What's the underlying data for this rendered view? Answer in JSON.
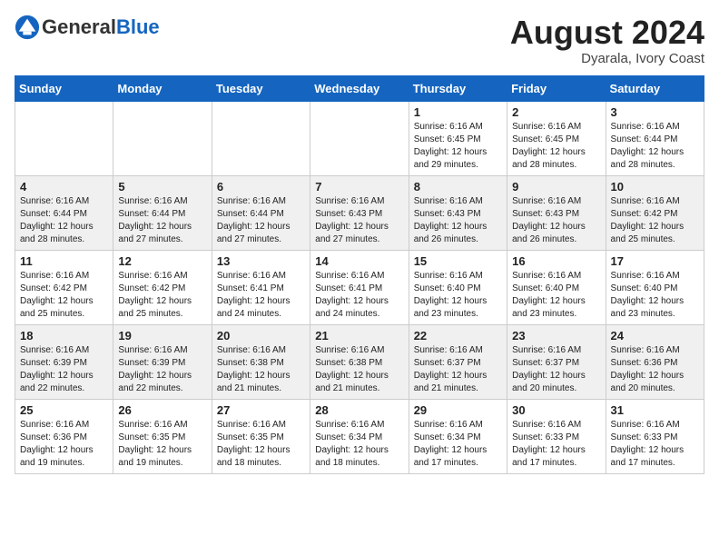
{
  "header": {
    "logo_general": "General",
    "logo_blue": "Blue",
    "month": "August 2024",
    "location": "Dyarala, Ivory Coast"
  },
  "days_of_week": [
    "Sunday",
    "Monday",
    "Tuesday",
    "Wednesday",
    "Thursday",
    "Friday",
    "Saturday"
  ],
  "weeks": [
    [
      {
        "day": "",
        "info": ""
      },
      {
        "day": "",
        "info": ""
      },
      {
        "day": "",
        "info": ""
      },
      {
        "day": "",
        "info": ""
      },
      {
        "day": "1",
        "info": "Sunrise: 6:16 AM\nSunset: 6:45 PM\nDaylight: 12 hours\nand 29 minutes."
      },
      {
        "day": "2",
        "info": "Sunrise: 6:16 AM\nSunset: 6:45 PM\nDaylight: 12 hours\nand 28 minutes."
      },
      {
        "day": "3",
        "info": "Sunrise: 6:16 AM\nSunset: 6:44 PM\nDaylight: 12 hours\nand 28 minutes."
      }
    ],
    [
      {
        "day": "4",
        "info": "Sunrise: 6:16 AM\nSunset: 6:44 PM\nDaylight: 12 hours\nand 28 minutes."
      },
      {
        "day": "5",
        "info": "Sunrise: 6:16 AM\nSunset: 6:44 PM\nDaylight: 12 hours\nand 27 minutes."
      },
      {
        "day": "6",
        "info": "Sunrise: 6:16 AM\nSunset: 6:44 PM\nDaylight: 12 hours\nand 27 minutes."
      },
      {
        "day": "7",
        "info": "Sunrise: 6:16 AM\nSunset: 6:43 PM\nDaylight: 12 hours\nand 27 minutes."
      },
      {
        "day": "8",
        "info": "Sunrise: 6:16 AM\nSunset: 6:43 PM\nDaylight: 12 hours\nand 26 minutes."
      },
      {
        "day": "9",
        "info": "Sunrise: 6:16 AM\nSunset: 6:43 PM\nDaylight: 12 hours\nand 26 minutes."
      },
      {
        "day": "10",
        "info": "Sunrise: 6:16 AM\nSunset: 6:42 PM\nDaylight: 12 hours\nand 25 minutes."
      }
    ],
    [
      {
        "day": "11",
        "info": "Sunrise: 6:16 AM\nSunset: 6:42 PM\nDaylight: 12 hours\nand 25 minutes."
      },
      {
        "day": "12",
        "info": "Sunrise: 6:16 AM\nSunset: 6:42 PM\nDaylight: 12 hours\nand 25 minutes."
      },
      {
        "day": "13",
        "info": "Sunrise: 6:16 AM\nSunset: 6:41 PM\nDaylight: 12 hours\nand 24 minutes."
      },
      {
        "day": "14",
        "info": "Sunrise: 6:16 AM\nSunset: 6:41 PM\nDaylight: 12 hours\nand 24 minutes."
      },
      {
        "day": "15",
        "info": "Sunrise: 6:16 AM\nSunset: 6:40 PM\nDaylight: 12 hours\nand 23 minutes."
      },
      {
        "day": "16",
        "info": "Sunrise: 6:16 AM\nSunset: 6:40 PM\nDaylight: 12 hours\nand 23 minutes."
      },
      {
        "day": "17",
        "info": "Sunrise: 6:16 AM\nSunset: 6:40 PM\nDaylight: 12 hours\nand 23 minutes."
      }
    ],
    [
      {
        "day": "18",
        "info": "Sunrise: 6:16 AM\nSunset: 6:39 PM\nDaylight: 12 hours\nand 22 minutes."
      },
      {
        "day": "19",
        "info": "Sunrise: 6:16 AM\nSunset: 6:39 PM\nDaylight: 12 hours\nand 22 minutes."
      },
      {
        "day": "20",
        "info": "Sunrise: 6:16 AM\nSunset: 6:38 PM\nDaylight: 12 hours\nand 21 minutes."
      },
      {
        "day": "21",
        "info": "Sunrise: 6:16 AM\nSunset: 6:38 PM\nDaylight: 12 hours\nand 21 minutes."
      },
      {
        "day": "22",
        "info": "Sunrise: 6:16 AM\nSunset: 6:37 PM\nDaylight: 12 hours\nand 21 minutes."
      },
      {
        "day": "23",
        "info": "Sunrise: 6:16 AM\nSunset: 6:37 PM\nDaylight: 12 hours\nand 20 minutes."
      },
      {
        "day": "24",
        "info": "Sunrise: 6:16 AM\nSunset: 6:36 PM\nDaylight: 12 hours\nand 20 minutes."
      }
    ],
    [
      {
        "day": "25",
        "info": "Sunrise: 6:16 AM\nSunset: 6:36 PM\nDaylight: 12 hours\nand 19 minutes."
      },
      {
        "day": "26",
        "info": "Sunrise: 6:16 AM\nSunset: 6:35 PM\nDaylight: 12 hours\nand 19 minutes."
      },
      {
        "day": "27",
        "info": "Sunrise: 6:16 AM\nSunset: 6:35 PM\nDaylight: 12 hours\nand 18 minutes."
      },
      {
        "day": "28",
        "info": "Sunrise: 6:16 AM\nSunset: 6:34 PM\nDaylight: 12 hours\nand 18 minutes."
      },
      {
        "day": "29",
        "info": "Sunrise: 6:16 AM\nSunset: 6:34 PM\nDaylight: 12 hours\nand 17 minutes."
      },
      {
        "day": "30",
        "info": "Sunrise: 6:16 AM\nSunset: 6:33 PM\nDaylight: 12 hours\nand 17 minutes."
      },
      {
        "day": "31",
        "info": "Sunrise: 6:16 AM\nSunset: 6:33 PM\nDaylight: 12 hours\nand 17 minutes."
      }
    ]
  ]
}
